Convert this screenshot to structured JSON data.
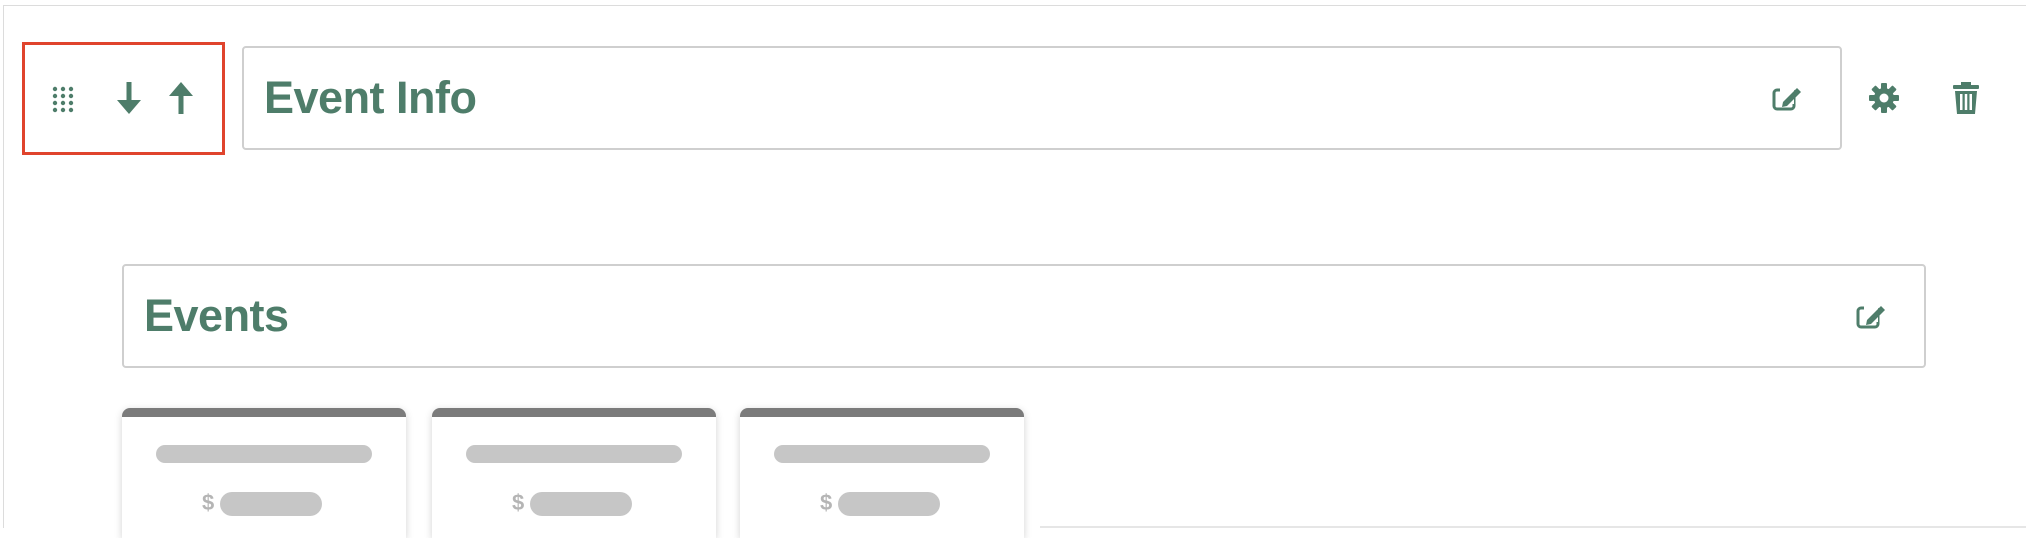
{
  "section": {
    "title": "Event Info"
  },
  "events_block": {
    "title": "Events",
    "cards": [
      {
        "currency_symbol": "$"
      },
      {
        "currency_symbol": "$"
      },
      {
        "currency_symbol": "$"
      }
    ]
  },
  "icons": {
    "drag": "drag-grid-icon",
    "move_down": "arrow-down-icon",
    "move_up": "arrow-up-icon",
    "edit": "edit-pencil-icon",
    "settings": "gear-icon",
    "delete": "trash-icon"
  },
  "colors": {
    "accent": "#4e7d6a",
    "highlight": "#e0442d",
    "border": "#cfcfcf",
    "placeholder": "#c6c6c6"
  }
}
